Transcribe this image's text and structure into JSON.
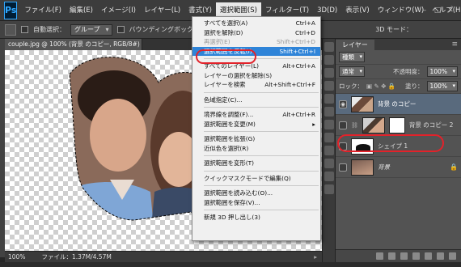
{
  "menubar": {
    "logo": "Ps",
    "items": [
      {
        "label": "ファイル(F)"
      },
      {
        "label": "編集(E)"
      },
      {
        "label": "イメージ(I)"
      },
      {
        "label": "レイヤー(L)"
      },
      {
        "label": "書式(Y)"
      },
      {
        "label": "選択範囲(S)"
      },
      {
        "label": "フィルター(T)"
      },
      {
        "label": "3D(D)"
      },
      {
        "label": "表示(V)"
      },
      {
        "label": "ウィンドウ(W)"
      },
      {
        "label": "ヘルプ(H)"
      }
    ]
  },
  "options": {
    "auto_select_label": "自動選択：",
    "auto_select_value": "グループ",
    "bounding_box_label": "バウンディングボックスを表示",
    "mode_3d_label": "3D モード："
  },
  "document": {
    "tab_title": "couple.jpg @ 100% (背景 のコピー, RGB/8#) *",
    "zoom": "100%",
    "file_info": "ファイル：1.37M/4.57M"
  },
  "menu": {
    "items": [
      {
        "label": "すべてを選択(A)",
        "shortcut": "Ctrl+A",
        "state": "normal"
      },
      {
        "label": "選択を解除(D)",
        "shortcut": "Ctrl+D",
        "state": "normal"
      },
      {
        "label": "再選択(E)",
        "shortcut": "Shift+Ctrl+D",
        "state": "disabled"
      },
      {
        "label": "選択範囲を反転(I)",
        "shortcut": "Shift+Ctrl+I",
        "state": "highlighted"
      },
      {
        "sep": true
      },
      {
        "label": "すべてのレイヤー(L)",
        "shortcut": "Alt+Ctrl+A",
        "state": "normal"
      },
      {
        "label": "レイヤーの選択を解除(S)",
        "shortcut": "",
        "state": "normal"
      },
      {
        "label": "レイヤーを検索",
        "shortcut": "Alt+Shift+Ctrl+F",
        "state": "normal"
      },
      {
        "sep": true
      },
      {
        "label": "色域指定(C)...",
        "shortcut": "",
        "state": "normal"
      },
      {
        "sep": true
      },
      {
        "label": "境界線を調整(F)...",
        "shortcut": "Alt+Ctrl+R",
        "state": "normal"
      },
      {
        "label": "選択範囲を変更(M)",
        "shortcut": "▸",
        "state": "normal"
      },
      {
        "sep": true
      },
      {
        "label": "選択範囲を拡張(G)",
        "shortcut": "",
        "state": "normal"
      },
      {
        "label": "近似色を選択(R)",
        "shortcut": "",
        "state": "normal"
      },
      {
        "sep": true
      },
      {
        "label": "選択範囲を変形(T)",
        "shortcut": "",
        "state": "normal"
      },
      {
        "sep": true
      },
      {
        "label": "クイックマスクモードで編集(Q)",
        "shortcut": "",
        "state": "normal"
      },
      {
        "sep": true
      },
      {
        "label": "選択範囲を読み込む(O)...",
        "shortcut": "",
        "state": "normal"
      },
      {
        "label": "選択範囲を保存(V)...",
        "shortcut": "",
        "state": "normal"
      },
      {
        "sep": true
      },
      {
        "label": "新規 3D 押し出し(3)",
        "shortcut": "",
        "state": "normal"
      }
    ]
  },
  "layers_panel": {
    "tab": "レイヤー",
    "filter_kind": "種類",
    "blend_mode": "通常",
    "opacity_label": "不透明度：",
    "opacity": "100%",
    "lock_label": "ロック：",
    "fill_label": "塗り：",
    "fill": "100%",
    "layers": [
      {
        "name": "背景 のコピー",
        "thumb": "photo",
        "selected": true,
        "visible": true,
        "mask": false
      },
      {
        "name": "背景 のコピー 2",
        "thumb": "photo2",
        "selected": false,
        "visible": false,
        "mask": true
      },
      {
        "name": "シェイプ 1",
        "thumb": "shape",
        "selected": false,
        "visible": false,
        "mask": false
      },
      {
        "name": "背景",
        "thumb": "bg",
        "selected": false,
        "visible": false,
        "mask": false,
        "locked": true
      }
    ]
  },
  "colors": {
    "highlight": "#2f84d8",
    "annotation": "#e2222a",
    "selected_layer": "#596a7d"
  }
}
